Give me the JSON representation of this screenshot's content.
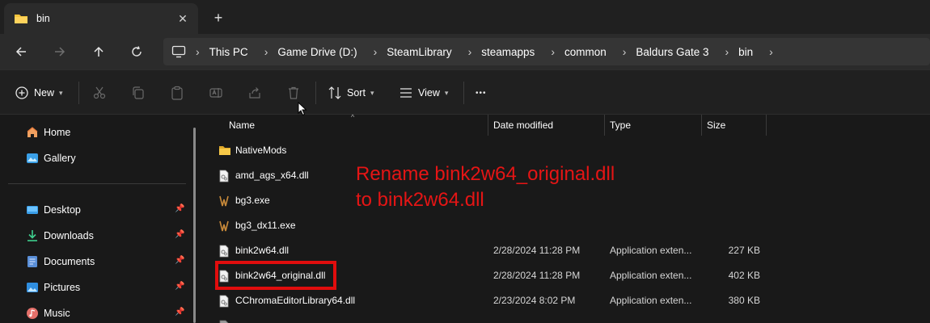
{
  "tab": {
    "title": "bin",
    "close_glyph": "✕",
    "new_tab_glyph": "+"
  },
  "nav": {
    "back": "←",
    "forward": "→",
    "up": "↑",
    "refresh": "↻"
  },
  "breadcrumbs": [
    "This PC",
    "Game Drive (D:)",
    "SteamLibrary",
    "steamapps",
    "common",
    "Baldurs Gate 3",
    "bin"
  ],
  "toolbar": {
    "new_label": "New",
    "sort_label": "Sort",
    "view_label": "View",
    "more_glyph": "•••"
  },
  "sidebar": {
    "top_items": [
      {
        "label": "Home",
        "icon": "home-icon"
      },
      {
        "label": "Gallery",
        "icon": "gallery-icon"
      }
    ],
    "pinned_items": [
      {
        "label": "Desktop",
        "icon": "desktop-icon"
      },
      {
        "label": "Downloads",
        "icon": "downloads-icon"
      },
      {
        "label": "Documents",
        "icon": "documents-icon"
      },
      {
        "label": "Pictures",
        "icon": "pictures-icon"
      },
      {
        "label": "Music",
        "icon": "music-icon"
      }
    ]
  },
  "columns": {
    "name": "Name",
    "date": "Date modified",
    "type": "Type",
    "size": "Size"
  },
  "files": [
    {
      "name": "NativeMods",
      "date": "",
      "type": "",
      "size": "",
      "icon": "folder-icon"
    },
    {
      "name": "amd_ags_x64.dll",
      "date": "",
      "type": "",
      "size": "",
      "icon": "dll-file-icon"
    },
    {
      "name": "bg3.exe",
      "date": "",
      "type": "",
      "size": "",
      "icon": "bg3-exe-icon"
    },
    {
      "name": "bg3_dx11.exe",
      "date": "",
      "type": "",
      "size": "",
      "icon": "bg3-exe-icon"
    },
    {
      "name": "bink2w64.dll",
      "date": "2/28/2024 11:28 PM",
      "type": "Application exten...",
      "size": "227 KB",
      "icon": "dll-file-icon"
    },
    {
      "name": "bink2w64_original.dll",
      "date": "2/28/2024 11:28 PM",
      "type": "Application exten...",
      "size": "402 KB",
      "icon": "dll-file-icon"
    },
    {
      "name": "CChromaEditorLibrary64.dll",
      "date": "2/23/2024 8:02 PM",
      "type": "Application exten...",
      "size": "380 KB",
      "icon": "dll-file-icon"
    }
  ],
  "annotation": {
    "line1": "Rename bink2w64_original.dll",
    "line2": "to bink2w64.dll",
    "color": "#e51515"
  },
  "colors": {
    "accent": "#60cdff",
    "folder": "#f4c33c",
    "highlight": "#e10d0d"
  }
}
